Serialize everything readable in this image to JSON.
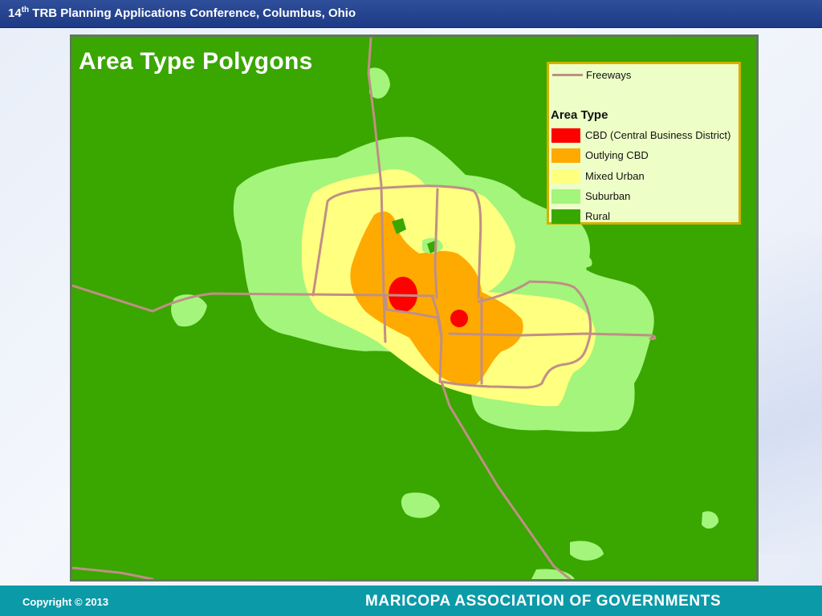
{
  "header": {
    "number": "14",
    "ordinal": "th",
    "conference": " TRB Planning Applications Conference, Columbus, Ohio"
  },
  "slide": {
    "title": "Area Type Polygons"
  },
  "legend": {
    "freeways_label": "Freeways",
    "area_type_heading": "Area Type",
    "items": [
      {
        "label": "CBD (Central Business District)",
        "color": "#ff0000"
      },
      {
        "label": "Outlying CBD",
        "color": "#ffaa00"
      },
      {
        "label": "Mixed Urban",
        "color": "#ffff80"
      },
      {
        "label": "Suburban",
        "color": "#a3f57c"
      },
      {
        "label": "Rural",
        "color": "#38a800"
      }
    ],
    "freeway_color": "#c08f86"
  },
  "map_colors": {
    "rural": "#38a800",
    "suburban": "#a3f57c",
    "mixed_urban": "#ffff80",
    "outlying_cbd": "#ffaa00",
    "cbd": "#ff0000",
    "freeway": "#c08f86"
  },
  "footer": {
    "copyright": "Copyright © 2013",
    "organization": "MARICOPA ASSOCIATION OF GOVERNMENTS"
  }
}
